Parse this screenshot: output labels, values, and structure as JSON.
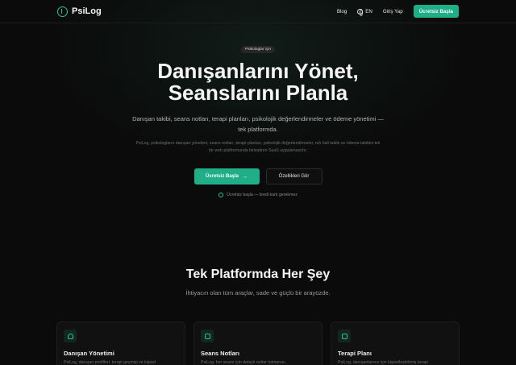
{
  "nav": {
    "brand": "PsiLog",
    "links": {
      "blog": "Blog",
      "lang": "EN",
      "login": "Giriş Yap"
    },
    "cta": "Ücretsiz Başla"
  },
  "hero": {
    "badge": "Psikologlar için",
    "title_line1": "Danışanlarını Yönet,",
    "title_line2": "Seanslarını Planla",
    "subtitle": "Danışan takibi, seans notları, terapi planları, psikolojik değerlendirmeler ve ödeme yönetimi — tek platformda.",
    "note": "PsiLog, psikologların danışan yönetimi, seans notları, terapi planları, psikolojik değerlendirmeler, ruh hali takibi ve ödeme takibini tek bir web platformunda birleştiren SaaS uygulamasıdır.",
    "cta_primary": "Ücretsiz Başla",
    "cta_secondary": "Özellikleri Gör",
    "free_note": "Ücretsiz başla — kredi kartı gerekmez"
  },
  "features": {
    "title": "Tek Platformda Her Şey",
    "subtitle": "İhtiyacın olan tüm araçlar, sade ve güçlü bir arayüzde.",
    "cards": [
      {
        "icon": "users-icon",
        "title": "Danışan Yönetimi",
        "desc": "PsiLog, danışan profilleri, terapi geçmişi ve kişisel"
      },
      {
        "icon": "document-icon",
        "title": "Seans Notları",
        "desc": "PsiLog, her seans için detaylı notlar tutmanızı,"
      },
      {
        "icon": "clipboard-icon",
        "title": "Terapi Planı",
        "desc": "PsiLog, danışanlarınız için kişiselleştirilmiş terapi"
      }
    ]
  },
  "colors": {
    "accent": "#1fae88",
    "background": "#0b0b0b"
  }
}
